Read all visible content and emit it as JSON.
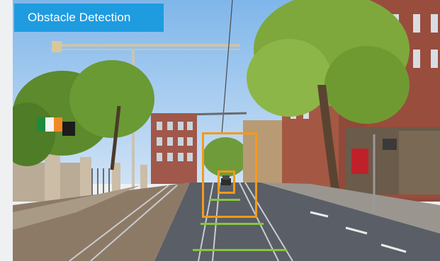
{
  "title": "Obstacle Detection",
  "colors": {
    "banner": "#1f9be0",
    "bbox": "#f39a1a",
    "distance_line": "#84c83a"
  },
  "scene": {
    "description_icons": [
      "street-scene",
      "tram-track",
      "trees",
      "buildings",
      "flags",
      "crane",
      "road-sign"
    ]
  },
  "detections": [
    {
      "name": "near-zone-box"
    },
    {
      "name": "obstacle-box"
    }
  ],
  "distance_markers": [
    {
      "name": "far"
    },
    {
      "name": "mid"
    },
    {
      "name": "near"
    }
  ]
}
